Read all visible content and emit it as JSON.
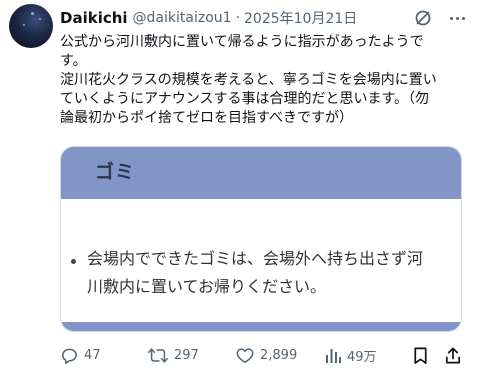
{
  "author": {
    "display_name": "Daikichi",
    "handle": "@daikitaizou1",
    "separator": "·",
    "date": "2025年10月21日"
  },
  "tweet": {
    "lines": [
      "公式から河川敷内に置いて帰るように指示があったようで",
      "す。",
      "淀川花火クラスの規模を考えると、寧ろゴミを会場内に置い",
      "ていくようにアナウンスする事は合理的だと思います。（勿",
      "論最初からポイ捨てゼロを目指すべきですが）"
    ]
  },
  "card": {
    "title": "ゴミ",
    "bullet_lines": [
      "会場内でできたゴミは、会場外へ持ち出さず河",
      "川敷内に置いてお帰りください。"
    ],
    "accent_color": "#8195c6"
  },
  "actions": {
    "reply_count": "47",
    "retweet_count": "297",
    "like_count": "2,899",
    "view_count": "49万"
  },
  "icons": [
    "grok-icon",
    "more-icon",
    "reply-icon",
    "retweet-icon",
    "like-icon",
    "views-icon",
    "bookmark-icon",
    "share-icon"
  ]
}
